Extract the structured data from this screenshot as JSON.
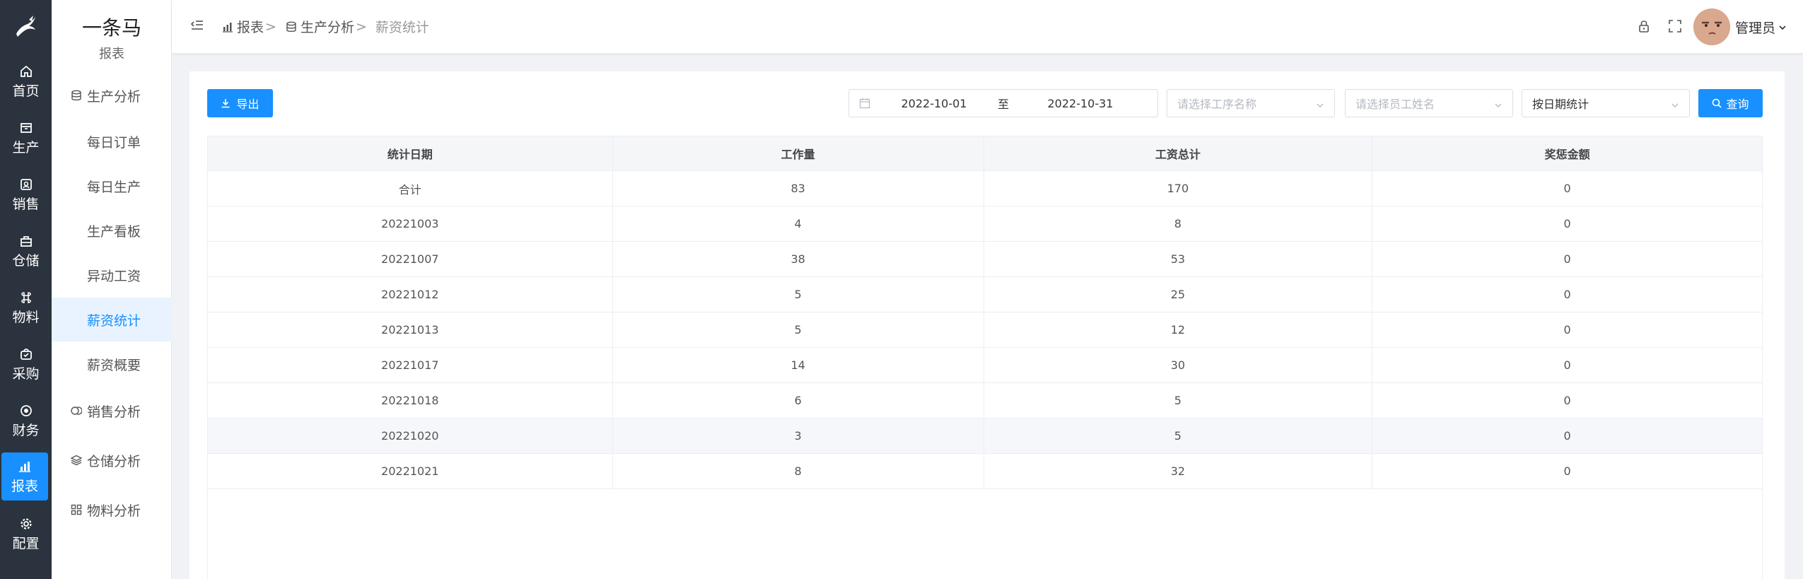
{
  "rail": {
    "items": [
      {
        "label": "首页",
        "icon": "home-icon"
      },
      {
        "label": "生产",
        "icon": "production-icon"
      },
      {
        "label": "销售",
        "icon": "sales-icon"
      },
      {
        "label": "仓储",
        "icon": "warehouse-icon"
      },
      {
        "label": "物料",
        "icon": "material-icon"
      },
      {
        "label": "采购",
        "icon": "purchase-icon"
      },
      {
        "label": "财务",
        "icon": "finance-icon"
      },
      {
        "label": "报表",
        "icon": "report-icon",
        "active": true
      },
      {
        "label": "配置",
        "icon": "gear-icon"
      }
    ]
  },
  "sidebar": {
    "brand": "一条马",
    "subtitle": "报表",
    "items": [
      {
        "label": "生产分析",
        "type": "group",
        "icon": "database-icon"
      },
      {
        "label": "每日订单",
        "type": "sub"
      },
      {
        "label": "每日生产",
        "type": "sub"
      },
      {
        "label": "生产看板",
        "type": "sub"
      },
      {
        "label": "异动工资",
        "type": "sub"
      },
      {
        "label": "薪资统计",
        "type": "sub",
        "active": true
      },
      {
        "label": "薪资概要",
        "type": "sub"
      },
      {
        "label": "销售分析",
        "type": "group",
        "icon": "coins-icon"
      },
      {
        "label": "仓储分析",
        "type": "group",
        "icon": "layers-icon"
      },
      {
        "label": "物料分析",
        "type": "group",
        "icon": "grid-icon"
      }
    ]
  },
  "header": {
    "breadcrumb": [
      "报表",
      "生产分析",
      "薪资统计"
    ],
    "breadcrumb_sep": ">",
    "user": "管理员"
  },
  "toolbar": {
    "export_label": "导出",
    "date_start": "2022-10-01",
    "date_to": "至",
    "date_end": "2022-10-31",
    "process_placeholder": "请选择工序名称",
    "employee_placeholder": "请选择员工姓名",
    "group_by": "按日期统计",
    "query_label": "查询"
  },
  "table": {
    "columns": [
      "统计日期",
      "工作量",
      "工资总计",
      "奖惩金额"
    ],
    "rows": [
      [
        "合计",
        "83",
        "170",
        "0"
      ],
      [
        "20221003",
        "4",
        "8",
        "0"
      ],
      [
        "20221007",
        "38",
        "53",
        "0"
      ],
      [
        "20221012",
        "5",
        "25",
        "0"
      ],
      [
        "20221013",
        "5",
        "12",
        "0"
      ],
      [
        "20221017",
        "14",
        "30",
        "0"
      ],
      [
        "20221018",
        "6",
        "5",
        "0"
      ],
      [
        "20221020",
        "3",
        "5",
        "0"
      ],
      [
        "20221021",
        "8",
        "32",
        "0"
      ]
    ],
    "highlight_row": 7
  },
  "colors": {
    "rail_bg": "#2b333e",
    "accent": "#1890ff",
    "active_bg": "#e8f3ff"
  }
}
